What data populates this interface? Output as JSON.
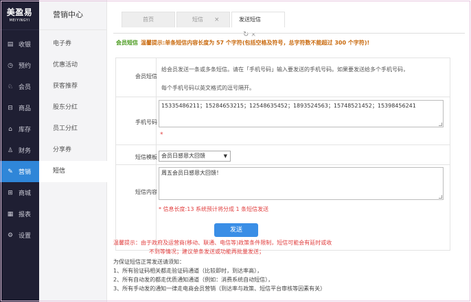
{
  "logo": {
    "main": "美盈易",
    "sub": "MEIYINGYI"
  },
  "nav": [
    {
      "icon": "▤",
      "icon_name": "cash-register-icon",
      "label": "收银"
    },
    {
      "icon": "◷",
      "icon_name": "clock-icon",
      "label": "预约"
    },
    {
      "icon": "♘",
      "icon_name": "member-icon",
      "label": "会员"
    },
    {
      "icon": "⊟",
      "icon_name": "goods-icon",
      "label": "商品"
    },
    {
      "icon": "⌂",
      "icon_name": "warehouse-icon",
      "label": "库存"
    },
    {
      "icon": "♙",
      "icon_name": "finance-icon",
      "label": "财务"
    },
    {
      "icon": "✎",
      "icon_name": "marketing-icon",
      "label": "营销"
    },
    {
      "icon": "⊞",
      "icon_name": "mall-icon",
      "label": "商城"
    },
    {
      "icon": "▦",
      "icon_name": "report-icon",
      "label": "报表"
    },
    {
      "icon": "⚙",
      "icon_name": "settings-icon",
      "label": "设置"
    }
  ],
  "submenu": {
    "title": "营销中心",
    "items": [
      "电子券",
      "优惠活动",
      "获客推荐",
      "股东分红",
      "员工分红",
      "分享券",
      "短信"
    ]
  },
  "tabs": [
    {
      "label": "首页"
    },
    {
      "label": "短信",
      "close": "×"
    },
    {
      "label": "发送短信",
      "refresh": "↻",
      "close": "×"
    }
  ],
  "notice": {
    "label": "会员短信",
    "text": "温馨提示:单条短信内容长度为 57 个字符(包括空格及符号，总字符数不能超过 300 个字符)!"
  },
  "form": {
    "member_label": "会员短信",
    "member_desc_line1": "给会员发送一条或多条短信。请在「手机号码」输入要发送的手机号码。如果要发送给多个手机号码，",
    "member_desc_line2": "每个手机号码以英文格式的逗号隔开。",
    "phone_label": "手机号码",
    "phone_value": "15335486211；15284653215；12548635452；1893524563；15748521452；15398456241",
    "required_mark": "*",
    "template_label": "短信模板",
    "template_selected": "会员日感恩大回馈",
    "template_arrow": "▼",
    "content_label": "短信内容",
    "content_value": "周五会员日感恩大回馈！",
    "content_hint": "* 信息长度:13 系统预计将分成 1 条短信发送"
  },
  "send_button": "发送",
  "warning": {
    "line1": "温馨提示：由于政府及运营商(移动、联通、电信等)政策条件限制，短信可能会有延时或收",
    "line2": "不到等情况；建议单条发送或功能再批量发送；"
  },
  "guide": {
    "title": "为保证短信正常发送请须知：",
    "items": [
      "1、所有验证码相关都走验证码通道（比较即时，到达率高），",
      "2、所有自动发的都走优质通知通道（例如：消费系统自动短信），",
      "3、所有手动发的通知一律走电商会员营销（到达率与政策、短信平台审核等因素有关）"
    ]
  }
}
